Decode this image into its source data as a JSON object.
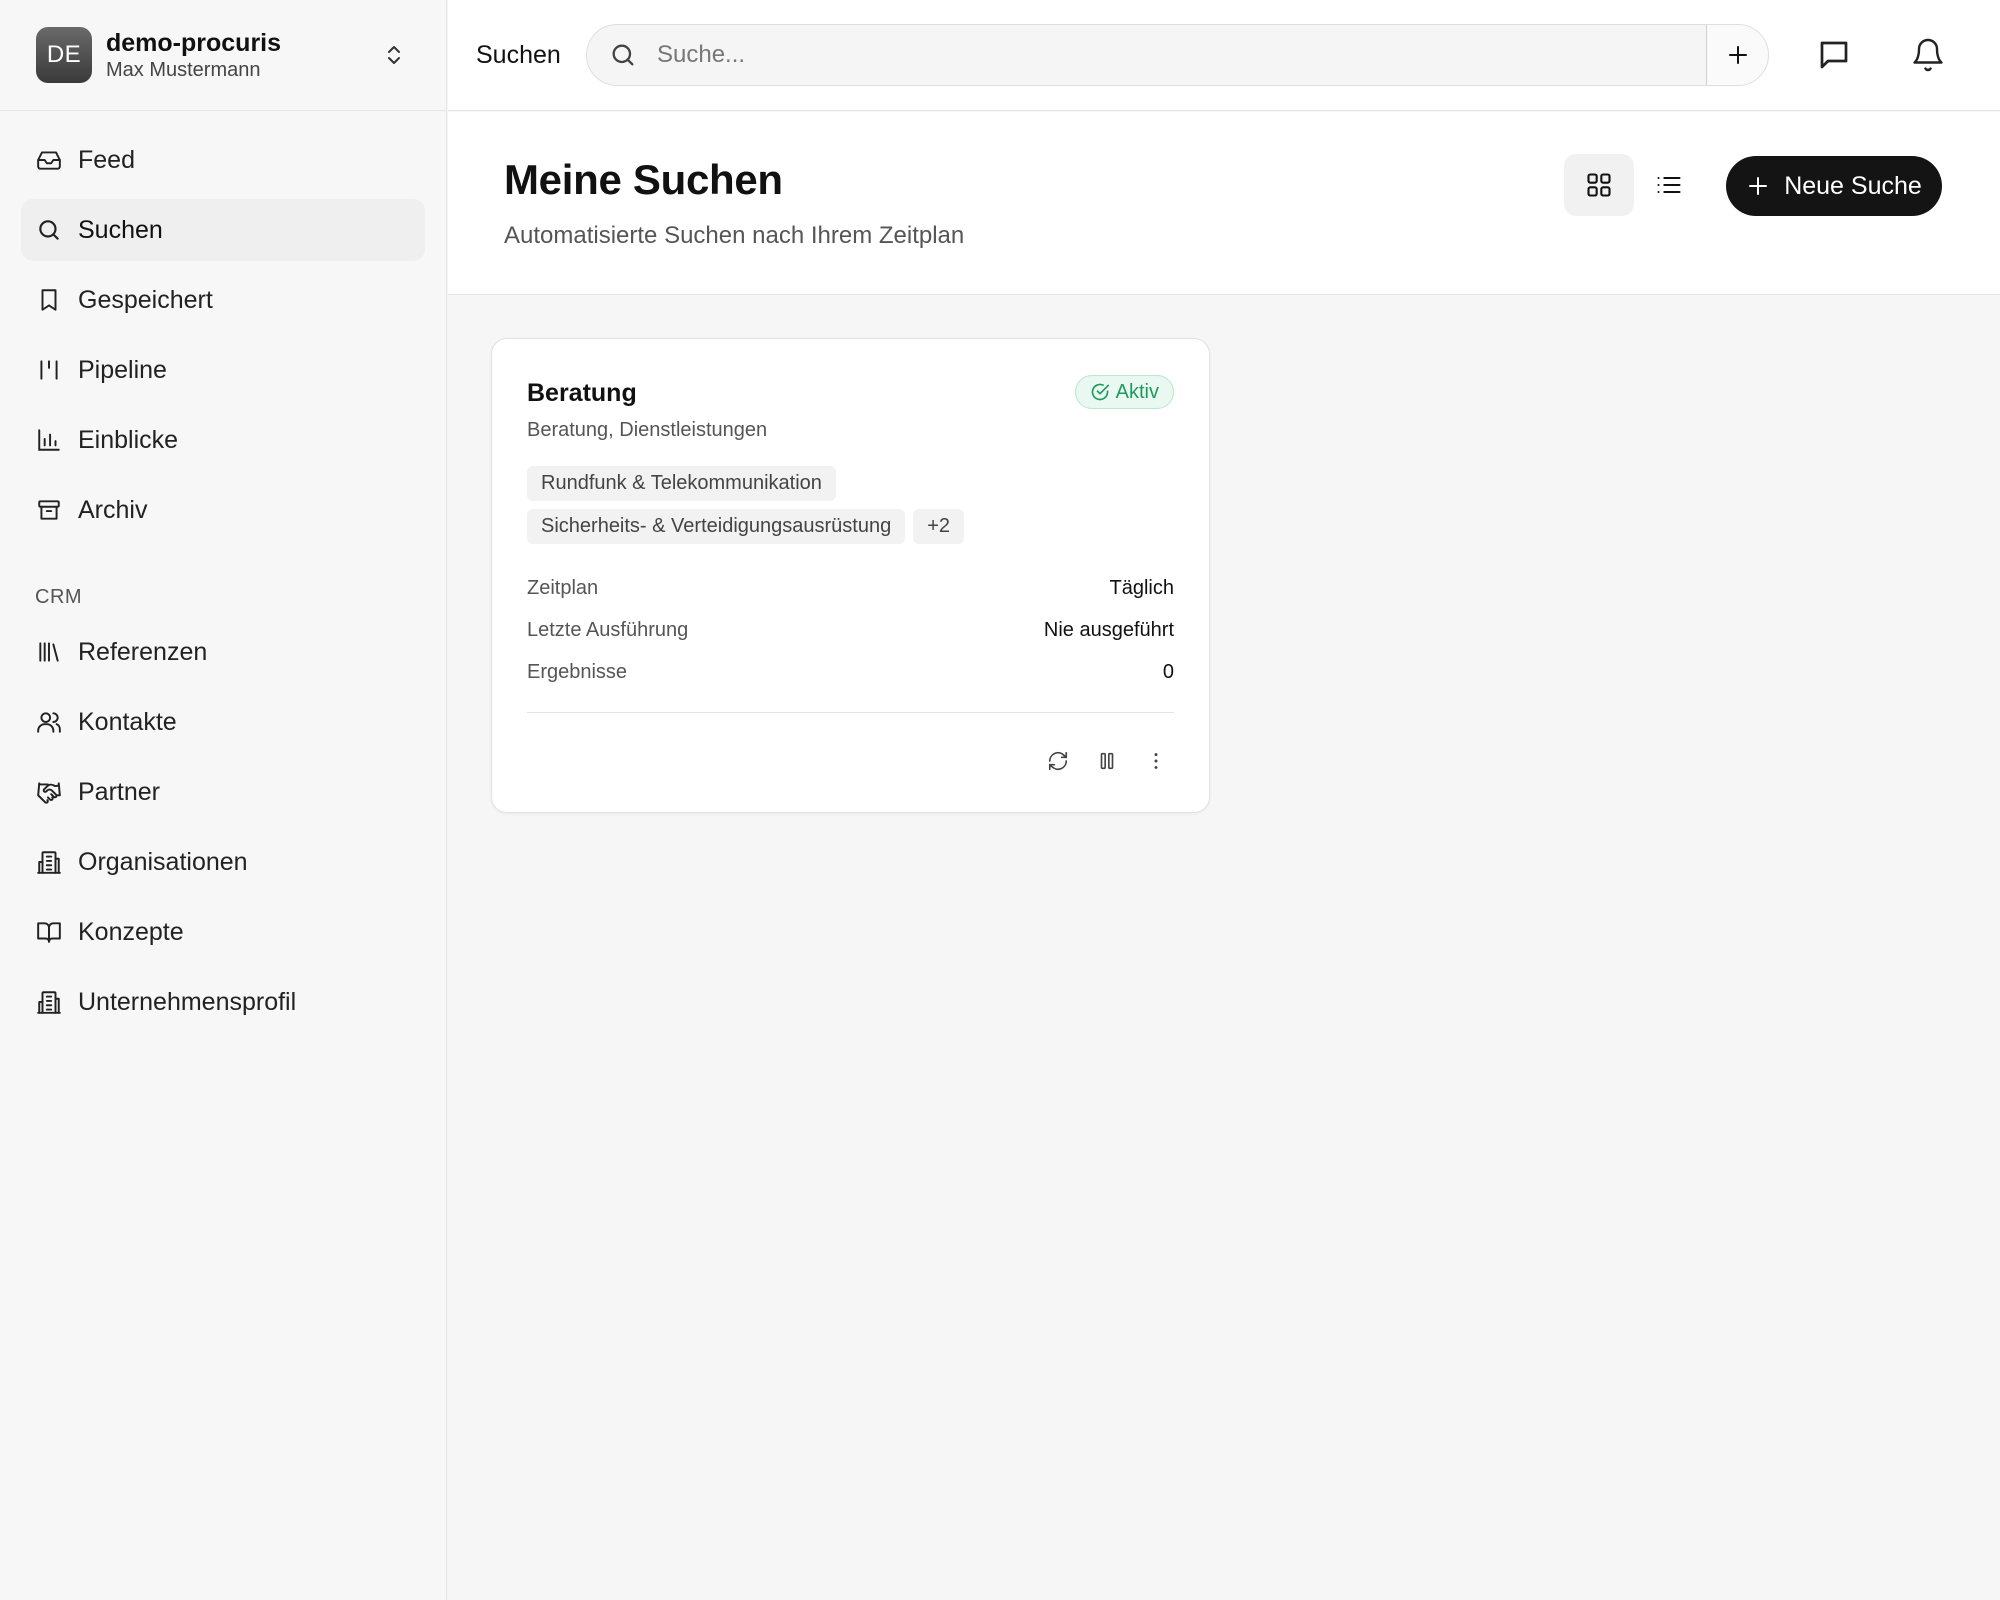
{
  "org": {
    "avatar_initials": "DE",
    "name": "demo-procuris",
    "user": "Max Mustermann"
  },
  "nav": {
    "items": [
      {
        "label": "Feed",
        "icon": "inbox-icon"
      },
      {
        "label": "Suchen",
        "icon": "search-icon",
        "active": true
      },
      {
        "label": "Gespeichert",
        "icon": "bookmark-icon"
      },
      {
        "label": "Pipeline",
        "icon": "pipeline-icon"
      },
      {
        "label": "Einblicke",
        "icon": "bar-chart-icon"
      },
      {
        "label": "Archiv",
        "icon": "archive-icon"
      }
    ],
    "crm_section_label": "CRM",
    "crm_items": [
      {
        "label": "Referenzen",
        "icon": "library-icon"
      },
      {
        "label": "Kontakte",
        "icon": "users-icon"
      },
      {
        "label": "Partner",
        "icon": "handshake-icon"
      },
      {
        "label": "Organisationen",
        "icon": "building-icon"
      },
      {
        "label": "Konzepte",
        "icon": "book-open-icon"
      },
      {
        "label": "Unternehmensprofil",
        "icon": "building-icon"
      }
    ]
  },
  "topbar": {
    "title": "Suchen",
    "search_placeholder": "Suche...",
    "search_value": ""
  },
  "page": {
    "title": "Meine Suchen",
    "subtitle": "Automatisierte Suchen nach Ihrem Zeitplan",
    "new_search_label": "Neue Suche",
    "view_mode": "grid"
  },
  "cards": [
    {
      "title": "Beratung",
      "status": "Aktiv",
      "subtitle": "Beratung, Dienstleistungen",
      "tags": [
        "Rundfunk & Telekommunikation",
        "Sicherheits- & Verteidigungsausrüstung"
      ],
      "more_tags": "+2",
      "meta": [
        {
          "key": "Zeitplan",
          "value": "Täglich"
        },
        {
          "key": "Letzte Ausführung",
          "value": "Nie ausgeführt"
        },
        {
          "key": "Ergebnisse",
          "value": "0"
        }
      ]
    }
  ],
  "colors": {
    "accent_dark": "#141414",
    "status_green": "#1f9a5d",
    "status_green_bg": "#e9f8f1",
    "active_nav_bg": "#efefef"
  }
}
